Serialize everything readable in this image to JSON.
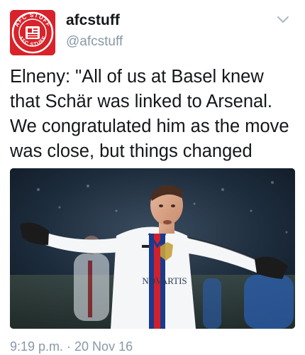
{
  "tweet": {
    "display_name": "afcstuff",
    "handle": "@afcstuff",
    "avatar_text": "AFC STUFF",
    "text": "Elneny: \"All of us at Basel knew that Schär was linked to Arsenal. We congratulated him as the move was close, but things changed quickly.\"",
    "timestamp": "9:19 p.m. · 20 Nov 16"
  },
  "media": {
    "shirt_sponsor": "NOVARTIS",
    "brand_color": "#d8232a"
  },
  "icons": {
    "menu": "chevron-down-icon",
    "avatar": "afc-stuff-logo"
  }
}
